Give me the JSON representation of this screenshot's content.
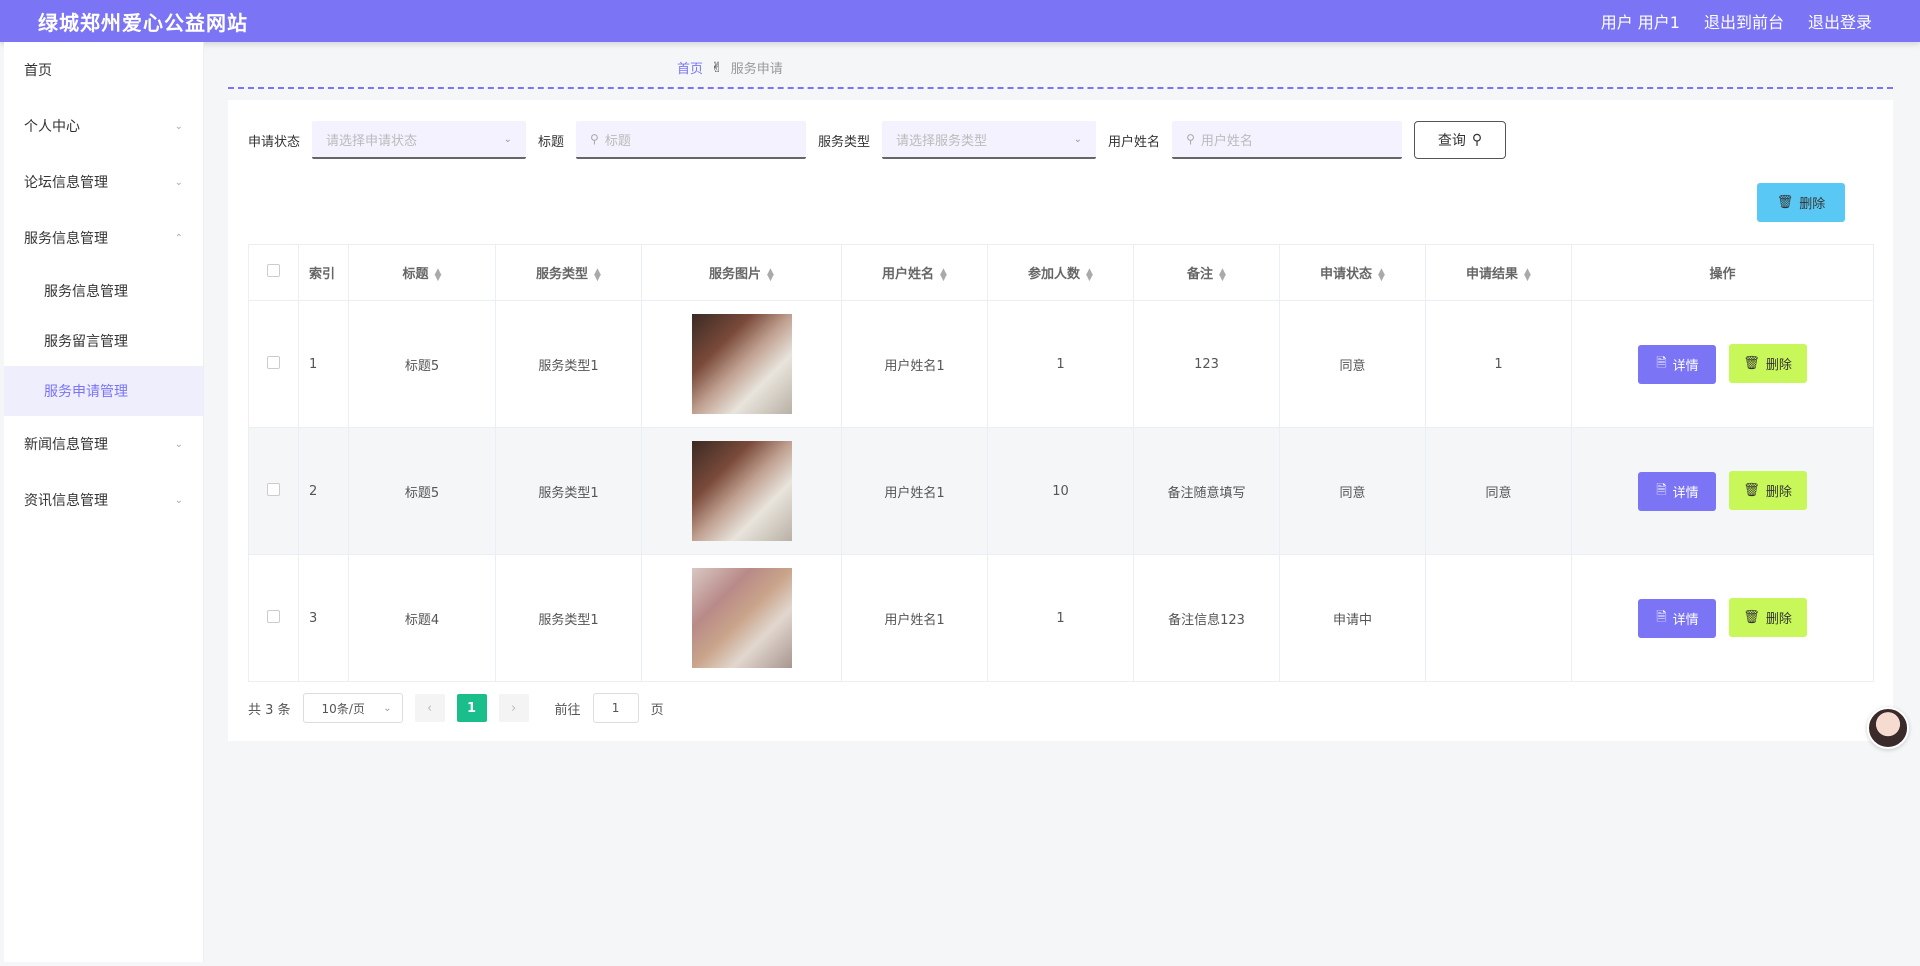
{
  "header": {
    "site_title": "绿城郑州爱心公益网站",
    "user_label": "用户 用户1",
    "back_to_front": "退出到前台",
    "logout": "退出登录"
  },
  "sidebar": {
    "items": [
      {
        "label": "首页"
      },
      {
        "label": "个人中心"
      },
      {
        "label": "论坛信息管理"
      },
      {
        "label": "服务信息管理"
      },
      {
        "label": "新闻信息管理"
      },
      {
        "label": "资讯信息管理"
      }
    ],
    "sub_items": [
      {
        "label": "服务信息管理"
      },
      {
        "label": "服务留言管理"
      },
      {
        "label": "服务申请管理"
      }
    ]
  },
  "breadcrumb": {
    "home": "首页",
    "current": "服务申请"
  },
  "filters": {
    "status_label": "申请状态",
    "status_placeholder": "请选择申请状态",
    "title_label": "标题",
    "title_placeholder": "标题",
    "type_label": "服务类型",
    "type_placeholder": "请选择服务类型",
    "username_label": "用户姓名",
    "username_placeholder": "用户姓名",
    "query_button": "查询"
  },
  "toolbar": {
    "delete_label": "删除"
  },
  "table": {
    "headers": [
      "索引",
      "标题",
      "服务类型",
      "服务图片",
      "用户姓名",
      "参加人数",
      "备注",
      "申请状态",
      "申请结果",
      "操作"
    ],
    "rows": [
      {
        "index": "1",
        "title": "标题5",
        "type": "服务类型1",
        "username": "用户姓名1",
        "count": "1",
        "note": "123",
        "status": "同意",
        "result": "1"
      },
      {
        "index": "2",
        "title": "标题5",
        "type": "服务类型1",
        "username": "用户姓名1",
        "count": "10",
        "note": "备注随意填写",
        "status": "同意",
        "result": "同意"
      },
      {
        "index": "3",
        "title": "标题4",
        "type": "服务类型1",
        "username": "用户姓名1",
        "count": "1",
        "note": "备注信息123",
        "status": "申请中",
        "result": ""
      }
    ],
    "detail_label": "详情",
    "delete_label": "删除"
  },
  "pagination": {
    "total": "共 3 条",
    "page_size": "10条/页",
    "current_page": "1",
    "goto_label": "前往",
    "goto_value": "1",
    "page_suffix": "页"
  }
}
